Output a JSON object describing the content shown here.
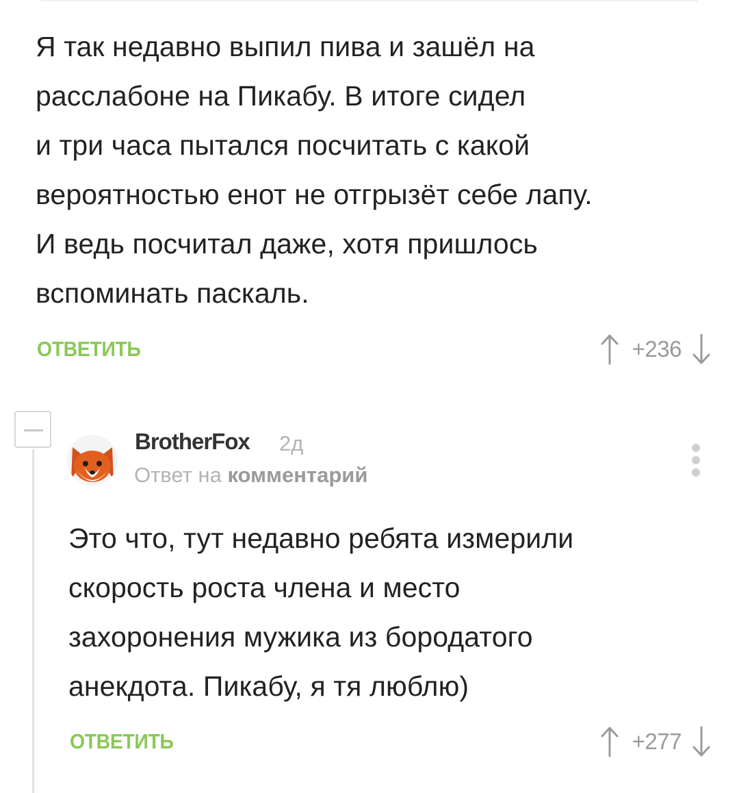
{
  "comments": [
    {
      "text": "Я так недавно выпил пива и зашёл на\nрасслабоне на Пикабу. В итоге сидел\nи три часа пытался посчитать с какой\nвероятностью енот не отгрызёт себе лапу.\nИ ведь посчитал даже, хотя пришлось\nвспоминать паскаль.",
      "reply_label": "ОТВЕТИТЬ",
      "rating": "+236"
    },
    {
      "author": "BrotherFox",
      "time": "2д",
      "reply_to_prefix": "Ответ на",
      "reply_to_link": "комментарий",
      "text": "Это что, тут недавно ребята измерили\nскорость роста члена и место\nзахоронения мужика из бородатого\nанекдота. Пикабу, я тя люблю)",
      "reply_label": "ОТВЕТИТЬ",
      "rating": "+277"
    }
  ],
  "icons": {
    "upvote": "arrow-up-icon",
    "downvote": "arrow-down-icon",
    "collapse": "minus-icon",
    "more": "vertical-dots-icon",
    "avatar": "fox-avatar"
  },
  "colors": {
    "accent": "#8ac858",
    "muted": "#b3b3b3",
    "text": "#222222"
  }
}
